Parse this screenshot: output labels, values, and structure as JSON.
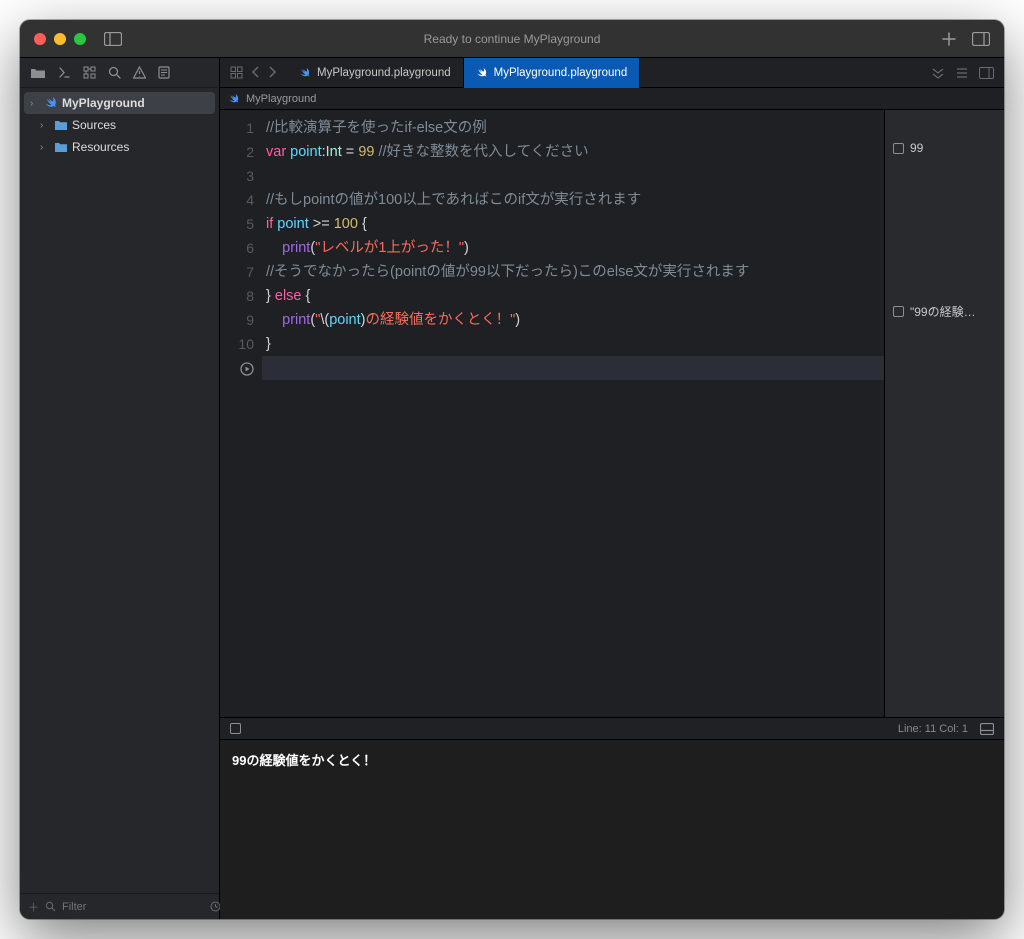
{
  "titlebar": {
    "title": "Ready to continue MyPlayground"
  },
  "sidebar": {
    "items": [
      {
        "label": "MyPlayground",
        "type": "swift",
        "selected": true,
        "depth": 0
      },
      {
        "label": "Sources",
        "type": "folder",
        "depth": 1
      },
      {
        "label": "Resources",
        "type": "folder",
        "depth": 1
      }
    ],
    "filter_placeholder": "Filter"
  },
  "tabs": [
    {
      "label": "MyPlayground.playground",
      "active": false
    },
    {
      "label": "MyPlayground.playground",
      "active": true
    }
  ],
  "breadcrumb": "MyPlayground",
  "code": {
    "lines": [
      {
        "n": "1",
        "tokens": [
          {
            "t": "//比較演算子を使ったif-else文の例",
            "c": "c-comment"
          }
        ]
      },
      {
        "n": "2",
        "tokens": [
          {
            "t": "var ",
            "c": "c-kw"
          },
          {
            "t": "point",
            "c": "c-var"
          },
          {
            "t": ":",
            "c": ""
          },
          {
            "t": "Int",
            "c": "c-type"
          },
          {
            "t": " = ",
            "c": ""
          },
          {
            "t": "99",
            "c": "c-num"
          },
          {
            "t": " ",
            "c": ""
          },
          {
            "t": "//好きな整数を代入してください",
            "c": "c-comment"
          }
        ]
      },
      {
        "n": "3",
        "tokens": []
      },
      {
        "n": "4",
        "tokens": [
          {
            "t": "//もしpointの値が100以上であればこのif文が実行されます",
            "c": "c-comment"
          }
        ]
      },
      {
        "n": "5",
        "tokens": [
          {
            "t": "if ",
            "c": "c-kw"
          },
          {
            "t": "point",
            "c": "c-var"
          },
          {
            "t": " >= ",
            "c": ""
          },
          {
            "t": "100",
            "c": "c-num"
          },
          {
            "t": " {",
            "c": ""
          }
        ]
      },
      {
        "n": "6",
        "tokens": [
          {
            "t": "    ",
            "c": ""
          },
          {
            "t": "print",
            "c": "c-fn"
          },
          {
            "t": "(",
            "c": ""
          },
          {
            "t": "\"レベルが1上がった！\"",
            "c": "c-str"
          },
          {
            "t": ")",
            "c": ""
          }
        ]
      },
      {
        "n": "7",
        "tokens": [
          {
            "t": "//そうでなかったら(pointの値が99以下だったら)このelse文が実行されます",
            "c": "c-comment"
          }
        ]
      },
      {
        "n": "8",
        "tokens": [
          {
            "t": "} ",
            "c": ""
          },
          {
            "t": "else",
            "c": "c-kw"
          },
          {
            "t": " {",
            "c": ""
          }
        ]
      },
      {
        "n": "9",
        "tokens": [
          {
            "t": "    ",
            "c": ""
          },
          {
            "t": "print",
            "c": "c-fn"
          },
          {
            "t": "(",
            "c": ""
          },
          {
            "t": "\"",
            "c": "c-str"
          },
          {
            "t": "\\(",
            "c": ""
          },
          {
            "t": "point",
            "c": "c-var"
          },
          {
            "t": ")",
            "c": ""
          },
          {
            "t": "の経験値をかくとく！\"",
            "c": "c-str"
          },
          {
            "t": ")",
            "c": ""
          }
        ]
      },
      {
        "n": "10",
        "tokens": [
          {
            "t": "}",
            "c": ""
          }
        ]
      }
    ],
    "run_glyph": "▶"
  },
  "results": [
    {
      "text": "99"
    },
    {
      "text": "\"99の経験…"
    }
  ],
  "statusbar": {
    "position": "Line: 11  Col: 1"
  },
  "console": {
    "output": "99の経験値をかくとく！"
  }
}
